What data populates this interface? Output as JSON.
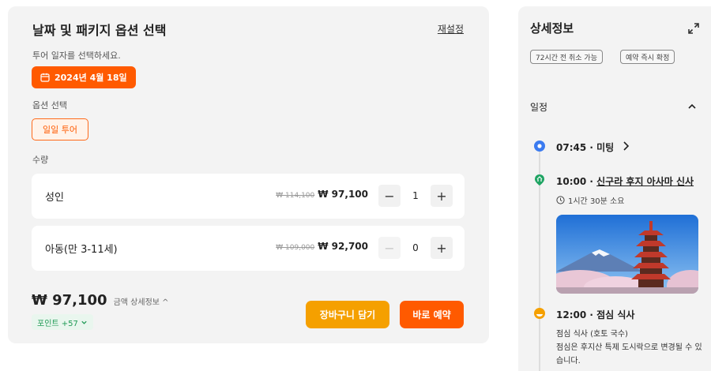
{
  "booking": {
    "title": "날짜 및 패키지 옵션 선택",
    "reset_label": "재설정",
    "date_prompt": "투어 일자를 선택하세요.",
    "selected_date": "2024년 4월 18일",
    "option_label": "옵션 선택",
    "selected_option": "일일 투어",
    "quantity_label": "수량",
    "rows": [
      {
        "name": "성인",
        "original_price": "₩ 114,100",
        "price": "₩ 97,100",
        "qty": "1",
        "minus_enabled": true
      },
      {
        "name": "아동(만 3-11세)",
        "original_price": "₩ 109,000",
        "price": "₩ 92,700",
        "qty": "0",
        "minus_enabled": false
      }
    ],
    "total_amount": "₩ 97,100",
    "price_detail_label": "금액 상세정보 ^",
    "points_label": "포인트 +57",
    "cart_label": "장바구니 담기",
    "book_label": "바로 예약"
  },
  "details": {
    "title": "상세정보",
    "tags": [
      "72시간 전 취소 가능",
      "예약 즉시 확정"
    ],
    "schedule_label": "일정",
    "schedule": [
      {
        "time": "07:45",
        "label": "미팅",
        "icon": "location-pin-icon"
      },
      {
        "time": "10:00",
        "label": "신구라 후지 아사마 신사",
        "icon": "landmark-icon",
        "duration": "1시간 30분 소요",
        "has_photo": true
      },
      {
        "time": "12:00",
        "label": "점심 식사",
        "icon": "meal-icon",
        "desc_1": "점심 식사 (호토 국수)",
        "desc_2": "점심은 후지산 특제 도시락으로 변경될 수 있습니다."
      }
    ]
  },
  "colors": {
    "accent": "#ff5a00",
    "cart": "#f5a000",
    "points": "#1f9a55",
    "pin": "#3b7bf0",
    "landmark": "#1fa463",
    "meal": "#f5a000"
  }
}
